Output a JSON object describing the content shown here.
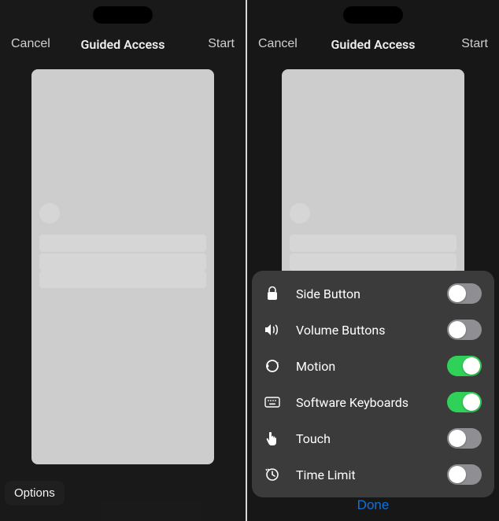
{
  "left": {
    "nav": {
      "cancel": "Cancel",
      "title": "Guided Access",
      "start": "Start"
    },
    "options_button": "Options"
  },
  "right": {
    "nav": {
      "cancel": "Cancel",
      "title": "Guided Access",
      "start": "Start"
    },
    "done": "Done",
    "options": [
      {
        "icon": "lock-icon",
        "label": "Side Button",
        "on": false
      },
      {
        "icon": "volume-icon",
        "label": "Volume Buttons",
        "on": false
      },
      {
        "icon": "motion-icon",
        "label": "Motion",
        "on": true
      },
      {
        "icon": "keyboard-icon",
        "label": "Software Keyboards",
        "on": true
      },
      {
        "icon": "touch-icon",
        "label": "Touch",
        "on": false
      },
      {
        "icon": "timelimit-icon",
        "label": "Time Limit",
        "on": false
      }
    ]
  }
}
